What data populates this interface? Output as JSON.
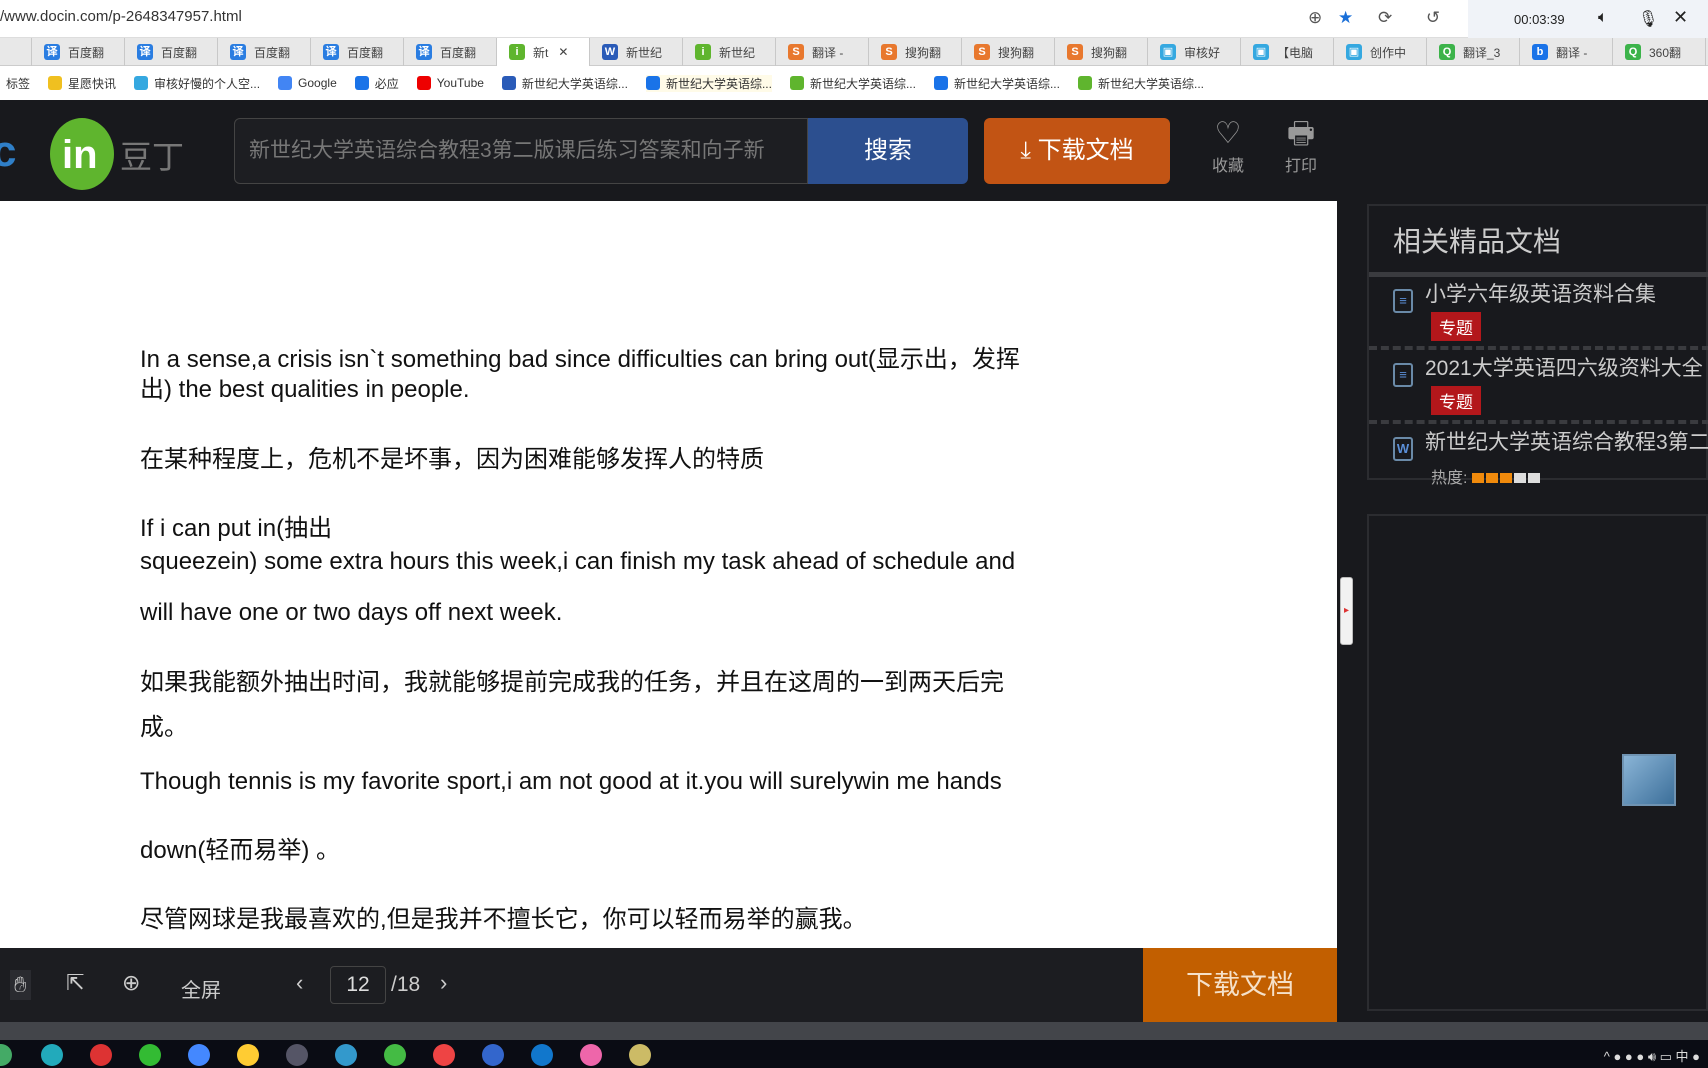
{
  "browser": {
    "url": "/www.docin.com/p-2648347957.html",
    "timer": "00:03:39",
    "tabs": [
      {
        "label": "",
        "icon": "blank"
      },
      {
        "label": "百度翻",
        "icon": "译"
      },
      {
        "label": "百度翻",
        "icon": "译"
      },
      {
        "label": "百度翻",
        "icon": "译"
      },
      {
        "label": "百度翻",
        "icon": "译"
      },
      {
        "label": "百度翻",
        "icon": "译"
      },
      {
        "label": "新t",
        "icon": "in",
        "active": true
      },
      {
        "label": "新世纪",
        "icon": "W"
      },
      {
        "label": "新世纪",
        "icon": "in"
      },
      {
        "label": "翻译 -",
        "icon": "S"
      },
      {
        "label": "搜狗翻",
        "icon": "S"
      },
      {
        "label": "搜狗翻",
        "icon": "S"
      },
      {
        "label": "搜狗翻",
        "icon": "S"
      },
      {
        "label": "审核好",
        "icon": "bili"
      },
      {
        "label": "【电脑",
        "icon": "bili"
      },
      {
        "label": "创作中",
        "icon": "bili"
      },
      {
        "label": "翻译_3",
        "icon": "Q"
      },
      {
        "label": "翻译 -",
        "icon": "b"
      },
      {
        "label": "360翻",
        "icon": "Q"
      }
    ],
    "bookmarks": [
      "标签",
      "星愿快讯",
      "审核好慢的个人空...",
      "Google",
      "必应",
      "YouTube",
      "新世纪大学英语综...",
      "新世纪大学英语综...",
      "新世纪大学英语综...",
      "新世纪大学英语综...",
      "新世纪大学英语综..."
    ]
  },
  "header": {
    "logo": "docin 豆丁",
    "search_placeholder": "新世纪大学英语综合教程3第二版课后练习答案和向子新",
    "search_label": "搜索",
    "download_label": "下载文档",
    "favorite_label": "收藏",
    "print_label": "打印"
  },
  "document": {
    "lines": [
      "In a sense,a crisis isn`t something bad since difficulties can bring out(显示出，发挥",
      "出) the best qualities in people.",
      "在某种程度上，危机不是坏事，因为困难能够发挥人的特质",
      "If i can put in(抽出",
      "squeezein) some extra hours this week,i can  finish my task ahead of schedule and",
      "will have one or two days off next week.",
      "如果我能额外抽出时间，我就能够提前完成我的任务，并且在这周的一到两天后完",
      "成。",
      "Though tennis is my favorite sport,i am not good at it.you will surelywin me hands",
      "down(轻而易举) 。",
      "尽管网球是我最喜欢的,但是我并不擅长它，你可以轻而易举的赢我。"
    ]
  },
  "sidebar": {
    "title": "相关精品文档",
    "items": [
      {
        "title": "小学六年级英语资料合集",
        "tag": "专题"
      },
      {
        "title": "2021大学英语四六级资料大全",
        "tag": "专题"
      },
      {
        "title": "新世纪大学英语综合教程3第二",
        "heat_label": "热度:",
        "heat_level": 3,
        "heat_max": 5
      }
    ],
    "heat_colors": {
      "on": "#f08a0c",
      "off": "#dddddd"
    }
  },
  "toolbar": {
    "fullscreen_label": "全屏",
    "current_page": "12",
    "total_pages": "/18",
    "download_label": "下载文档"
  }
}
